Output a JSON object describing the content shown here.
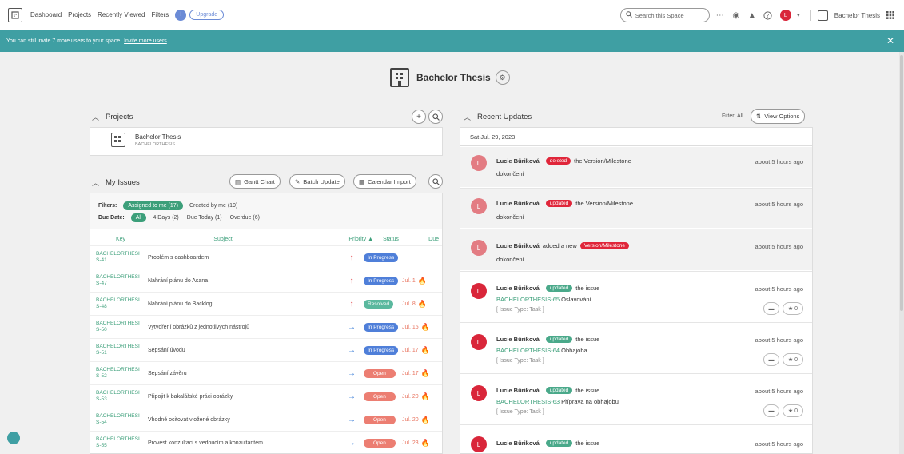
{
  "topbar": {
    "nav": [
      "Dashboard",
      "Projects",
      "Recently Viewed",
      "Filters"
    ],
    "upgrade": "Upgrade",
    "search_placeholder": "Search this Space",
    "user_initial": "L",
    "space_name": "Bachelor Thesis"
  },
  "banner": {
    "text": "You can still invite 7 more users to your space.",
    "link": "Invite more users"
  },
  "space": {
    "title": "Bachelor Thesis"
  },
  "projects": {
    "heading": "Projects",
    "items": [
      {
        "name": "Bachelor Thesis",
        "key": "BACHELORTHESIS"
      }
    ]
  },
  "my_issues": {
    "heading": "My Issues",
    "buttons": {
      "gantt": "Gantt Chart",
      "batch": "Batch Update",
      "calendar": "Calendar Import"
    },
    "filters_label": "Filters:",
    "filter_assigned": "Assigned to me (17)",
    "filter_created": "Created by me (19)",
    "due_label": "Due Date:",
    "due_all": "All",
    "due_4days": "4 Days (2)",
    "due_today": "Due Today (1)",
    "due_overdue": "Overdue (6)",
    "columns": {
      "key": "Key",
      "subject": "Subject",
      "priority": "Priority ▲",
      "status": "Status",
      "due": "Due"
    },
    "rows": [
      {
        "key1": "BACHELORTHESI",
        "key2": "S-41",
        "subject": "Problém s dashboardem",
        "priority": "high",
        "status": "In Progress",
        "status_type": "progress",
        "due": ""
      },
      {
        "key1": "BACHELORTHESI",
        "key2": "S-47",
        "subject": "Nahrání plánu do Asana",
        "priority": "high",
        "status": "In Progress",
        "status_type": "progress",
        "due": "Jul. 1"
      },
      {
        "key1": "BACHELORTHESI",
        "key2": "S-48",
        "subject": "Nahrání plánu do Backlog",
        "priority": "high",
        "status": "Resolved",
        "status_type": "resolved",
        "due": "Jul. 8"
      },
      {
        "key1": "BACHELORTHESI",
        "key2": "S-50",
        "subject": "Vytvoření obrázků z jednotlivých nástrojů",
        "priority": "normal",
        "status": "In Progress",
        "status_type": "progress",
        "due": "Jul. 15"
      },
      {
        "key1": "BACHELORTHESI",
        "key2": "S-51",
        "subject": "Sepsání úvodu",
        "priority": "normal",
        "status": "In Progress",
        "status_type": "progress",
        "due": "Jul. 17"
      },
      {
        "key1": "BACHELORTHESI",
        "key2": "S-52",
        "subject": "Sepsání závěru",
        "priority": "normal",
        "status": "Open",
        "status_type": "open",
        "due": "Jul. 17"
      },
      {
        "key1": "BACHELORTHESI",
        "key2": "S-53",
        "subject": "Připojit k bakalářské práci obrázky",
        "priority": "normal",
        "status": "Open",
        "status_type": "open",
        "due": "Jul. 20"
      },
      {
        "key1": "BACHELORTHESI",
        "key2": "S-54",
        "subject": "Vhodně ocitovat vložené obrázky",
        "priority": "normal",
        "status": "Open",
        "status_type": "open",
        "due": "Jul. 20"
      },
      {
        "key1": "BACHELORTHESI",
        "key2": "S-55",
        "subject": "Provést konzultaci s vedoucím a konzultantem",
        "priority": "normal",
        "status": "Open",
        "status_type": "open",
        "due": "Jul. 23"
      }
    ]
  },
  "recent": {
    "heading": "Recent Updates",
    "filter_label": "Filter: All",
    "view_options": "View Options",
    "date": "Sat Jul. 29, 2023",
    "items": [
      {
        "user": "Lucie Bůriková",
        "action": "deleted",
        "text": "the Version/Milestone",
        "subject": "dokončení",
        "time": "about 5 hours ago"
      },
      {
        "user": "Lucie Bůriková",
        "action": "updated",
        "text": "the Version/Milestone",
        "subject": "dokončení",
        "time": "about 5 hours ago"
      },
      {
        "user": "Lucie Bůriková",
        "action_pre": "added a new",
        "tag": "Version/Milestone",
        "subject": "dokončení",
        "time": "about 5 hours ago"
      },
      {
        "user": "Lucie Bůriková",
        "action": "updated",
        "text": "the issue",
        "issue_key": "BACHELORTHESIS-65",
        "issue_title": "Oslavování",
        "meta": "[ Issue Type: Task ]",
        "time": "about 5 hours ago",
        "stars": "0"
      },
      {
        "user": "Lucie Bůriková",
        "action": "updated",
        "text": "the issue",
        "issue_key": "BACHELORTHESIS-64",
        "issue_title": "Obhajoba",
        "meta": "[ Issue Type: Task ]",
        "time": "about 5 hours ago",
        "stars": "0"
      },
      {
        "user": "Lucie Bůriková",
        "action": "updated",
        "text": "the issue",
        "issue_key": "BACHELORTHESIS-63",
        "issue_title": "Příprava na obhajobu",
        "meta": "[ Issue Type: Task ]",
        "time": "about 5 hours ago",
        "stars": "0"
      },
      {
        "user": "Lucie Bůriková",
        "action": "updated",
        "text": "the issue",
        "time": "about 5 hours ago"
      }
    ]
  }
}
